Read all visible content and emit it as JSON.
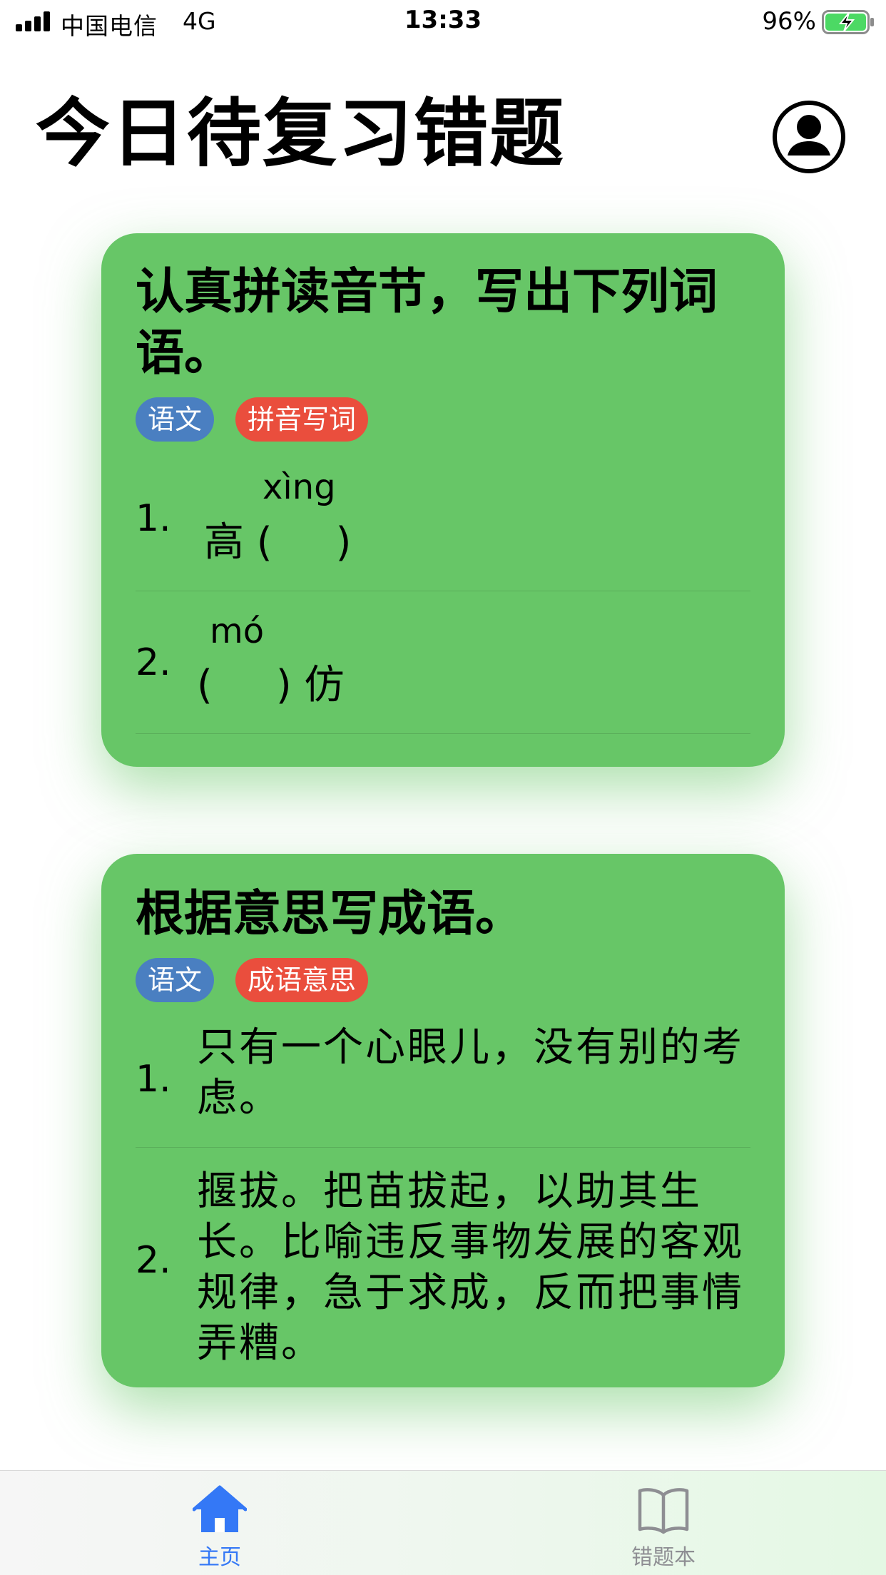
{
  "status_bar": {
    "carrier": "中国电信",
    "network": "4G",
    "time": "13:33",
    "battery_percent": "96%"
  },
  "header": {
    "title": "今日待复习错题",
    "account_icon": "user-circle-icon"
  },
  "cards": [
    {
      "title": "认真拼读音节，写出下列词语。",
      "tags": {
        "subject": "语文",
        "topic": "拼音写词"
      },
      "questions": [
        {
          "number": "1.",
          "pinyin": "xìng",
          "text": "高 (     )"
        },
        {
          "number": "2.",
          "pinyin": "mó",
          "text": "(     ) 仿"
        }
      ]
    },
    {
      "title": "根据意思写成语。",
      "tags": {
        "subject": "语文",
        "topic": "成语意思"
      },
      "questions": [
        {
          "number": "1.",
          "text": "只有一个心眼儿，没有别的考虑。"
        },
        {
          "number": "2.",
          "text": "揠拔。把苗拔起，以助其生长。比喻违反事物发展的客观规律，急于求成，反而把事情弄糟。"
        }
      ]
    }
  ],
  "tab_bar": {
    "tabs": [
      {
        "label": "主页",
        "icon": "home-icon",
        "active": true
      },
      {
        "label": "错题本",
        "icon": "book-icon",
        "active": false
      }
    ],
    "active_color": "#3478f6",
    "inactive_color": "#8e8e93"
  },
  "colors": {
    "card": "#67c667",
    "tag_subject": "#4a7fc1",
    "tag_topic": "#ea4e3d"
  }
}
